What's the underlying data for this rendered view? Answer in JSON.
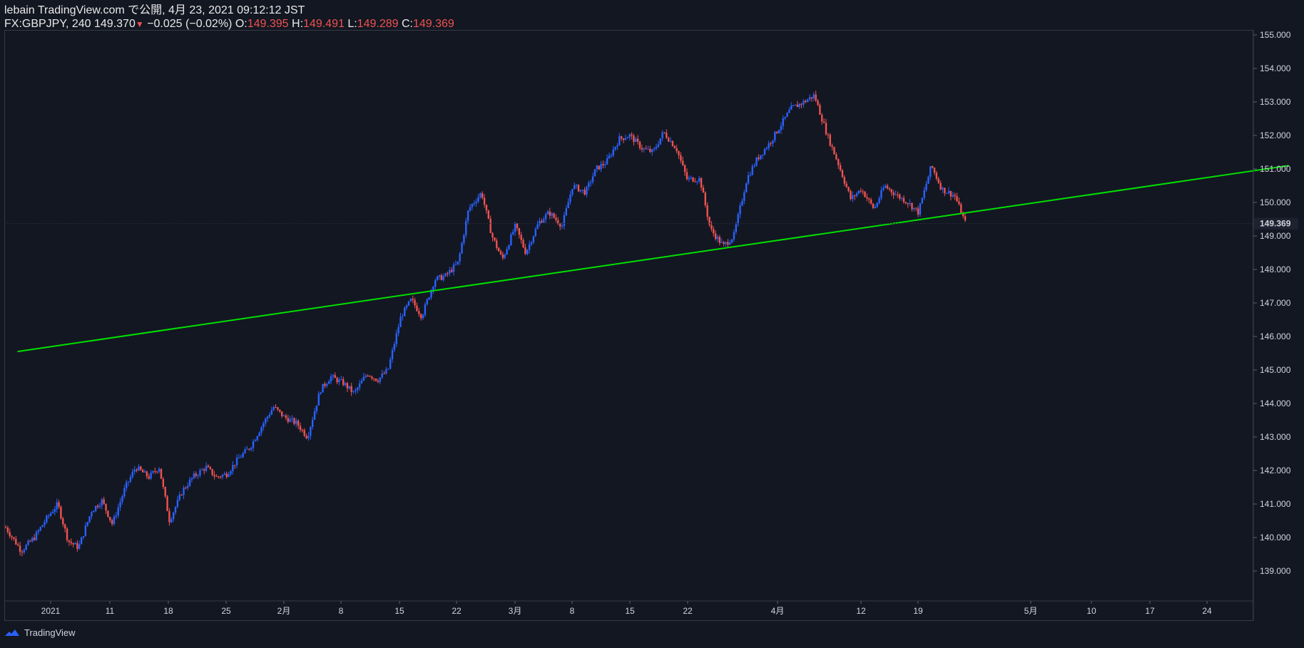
{
  "header": {
    "publisher": "lebain TradingView.com で公開, 4月 23, 2021 09:12:12 JST",
    "symbol": "FX:GBPJPY, 240",
    "last": "149.370",
    "change_arrow": "▼",
    "change": "−0.025 (−0.02%)",
    "o_label": "O:",
    "o_value": "149.395",
    "h_label": "H:",
    "h_value": "149.491",
    "l_label": "L:",
    "l_value": "149.289",
    "c_label": "C:",
    "c_value": "149.369"
  },
  "footer": {
    "brand": "TradingView"
  },
  "colors": {
    "background": "#131722",
    "up": "#2962ff",
    "down": "#ef5350",
    "trendline": "#00e000",
    "price_badge": "#1e2230"
  },
  "chart_data": {
    "type": "candlestick",
    "symbol": "GBPJPY",
    "timeframe": "240",
    "ylim": [
      138.0,
      155.0
    ],
    "y_ticks": [
      "139.000",
      "140.000",
      "141.000",
      "142.000",
      "143.000",
      "144.000",
      "145.000",
      "146.000",
      "147.000",
      "148.000",
      "149.000",
      "150.000",
      "151.000",
      "152.000",
      "153.000",
      "154.000",
      "155.000"
    ],
    "last_price_label": "149.369",
    "last_price": 149.369,
    "x_ticks": [
      "2021",
      "11",
      "18",
      "25",
      "2月",
      "8",
      "15",
      "22",
      "3月",
      "8",
      "15",
      "22",
      "4月",
      "12",
      "19",
      "5月",
      "10",
      "17",
      "24"
    ],
    "price_path": [
      [
        0,
        140.3
      ],
      [
        6,
        139.6
      ],
      [
        11,
        140.0
      ],
      [
        16,
        140.6
      ],
      [
        20,
        141.0
      ],
      [
        24,
        139.9
      ],
      [
        28,
        139.7
      ],
      [
        33,
        140.8
      ],
      [
        37,
        141.1
      ],
      [
        41,
        140.4
      ],
      [
        46,
        141.5
      ],
      [
        50,
        142.1
      ],
      [
        55,
        141.8
      ],
      [
        59,
        142.1
      ],
      [
        63,
        140.5
      ],
      [
        68,
        141.4
      ],
      [
        72,
        141.8
      ],
      [
        77,
        142.1
      ],
      [
        81,
        141.8
      ],
      [
        85,
        141.9
      ],
      [
        90,
        142.4
      ],
      [
        94,
        142.7
      ],
      [
        99,
        143.4
      ],
      [
        103,
        143.9
      ],
      [
        107,
        143.6
      ],
      [
        112,
        143.4
      ],
      [
        116,
        143.0
      ],
      [
        121,
        144.4
      ],
      [
        125,
        144.8
      ],
      [
        130,
        144.6
      ],
      [
        134,
        144.3
      ],
      [
        139,
        144.9
      ],
      [
        143,
        144.7
      ],
      [
        147,
        145.0
      ],
      [
        152,
        146.6
      ],
      [
        156,
        147.1
      ],
      [
        160,
        146.6
      ],
      [
        165,
        147.7
      ],
      [
        169,
        147.8
      ],
      [
        174,
        148.2
      ],
      [
        178,
        149.8
      ],
      [
        183,
        150.3
      ],
      [
        187,
        149.0
      ],
      [
        191,
        148.3
      ],
      [
        196,
        149.3
      ],
      [
        200,
        148.5
      ],
      [
        205,
        149.4
      ],
      [
        209,
        149.7
      ],
      [
        214,
        149.3
      ],
      [
        218,
        150.5
      ],
      [
        223,
        150.3
      ],
      [
        227,
        151.0
      ],
      [
        231,
        151.2
      ],
      [
        236,
        151.9
      ],
      [
        240,
        152.0
      ],
      [
        245,
        151.6
      ],
      [
        249,
        151.5
      ],
      [
        253,
        152.1
      ],
      [
        258,
        151.6
      ],
      [
        262,
        150.7
      ],
      [
        267,
        150.7
      ],
      [
        271,
        149.2
      ],
      [
        276,
        148.7
      ],
      [
        280,
        149.0
      ],
      [
        285,
        150.7
      ],
      [
        289,
        151.3
      ],
      [
        294,
        151.8
      ],
      [
        298,
        152.3
      ],
      [
        302,
        152.8
      ],
      [
        307,
        153.0
      ],
      [
        311,
        153.2
      ],
      [
        316,
        152.0
      ],
      [
        320,
        151.2
      ],
      [
        325,
        150.1
      ],
      [
        329,
        150.4
      ],
      [
        334,
        149.8
      ],
      [
        338,
        150.5
      ],
      [
        343,
        150.2
      ],
      [
        347,
        150.0
      ],
      [
        351,
        149.7
      ],
      [
        356,
        151.1
      ],
      [
        360,
        150.4
      ],
      [
        365,
        150.2
      ],
      [
        369,
        149.4
      ]
    ],
    "trendline": {
      "x1_date": "2020-12-28",
      "y1": 145.55,
      "x2_date": "2021-05-31",
      "y2": 151.1
    }
  }
}
